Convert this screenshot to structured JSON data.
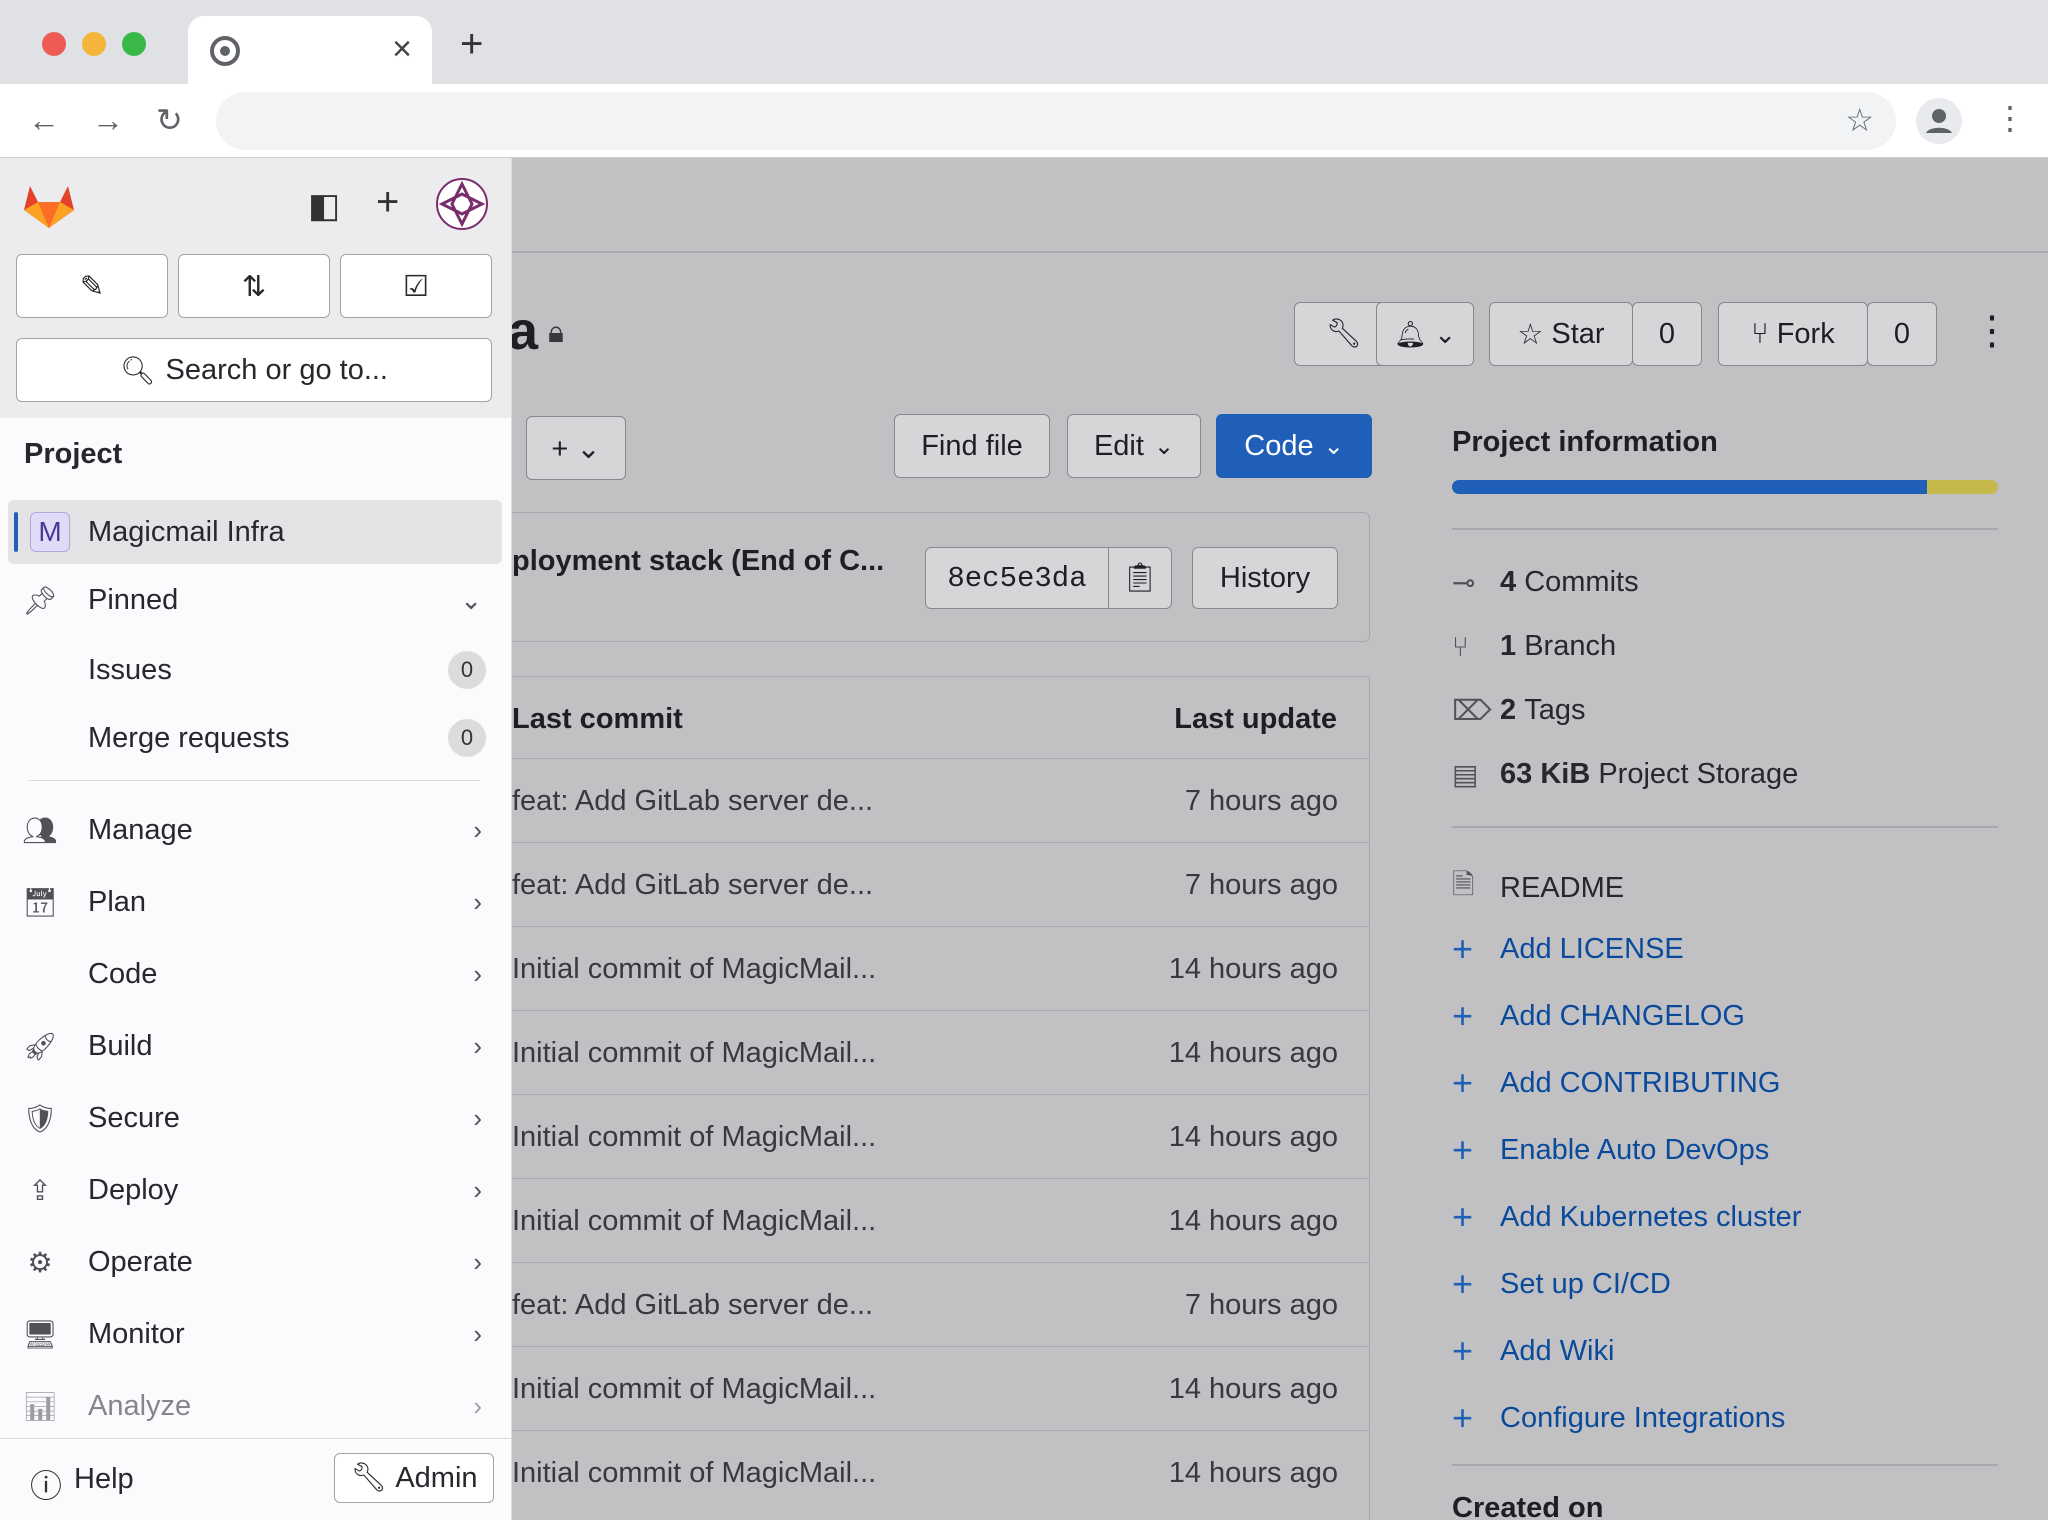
{
  "browser": {
    "tab_close": "×",
    "new_tab": "+"
  },
  "sidebar": {
    "search_placeholder": "Search or go to...",
    "section_title": "Project",
    "project_initial": "M",
    "project_name": "Magicmail Infra",
    "pinned_label": "Pinned",
    "pinned_items": [
      {
        "label": "Issues",
        "count": "0"
      },
      {
        "label": "Merge requests",
        "count": "0"
      }
    ],
    "nav": [
      "Manage",
      "Plan",
      "Code",
      "Build",
      "Secure",
      "Deploy",
      "Operate",
      "Monitor",
      "Analyze"
    ],
    "help_label": "Help",
    "admin_label": "Admin"
  },
  "header": {
    "title_fragment": "a",
    "star_label": "Star",
    "star_count": "0",
    "fork_label": "Fork",
    "fork_count": "0"
  },
  "repo": {
    "find_file": "Find file",
    "edit": "Edit",
    "code": "Code",
    "commit_title": "ployment stack (End of C...",
    "commit_sha": "8ec5e3da",
    "history": "History",
    "col_last_commit": "Last commit",
    "col_last_update": "Last update",
    "rows": [
      {
        "commit": "feat: Add GitLab server de...",
        "time": "7 hours ago"
      },
      {
        "commit": "feat: Add GitLab server de...",
        "time": "7 hours ago"
      },
      {
        "commit": "Initial commit of MagicMail...",
        "time": "14 hours ago"
      },
      {
        "commit": "Initial commit of MagicMail...",
        "time": "14 hours ago"
      },
      {
        "commit": "Initial commit of MagicMail...",
        "time": "14 hours ago"
      },
      {
        "commit": "Initial commit of MagicMail...",
        "time": "14 hours ago"
      },
      {
        "commit": "feat: Add GitLab server de...",
        "time": "7 hours ago"
      },
      {
        "commit": "Initial commit of MagicMail...",
        "time": "14 hours ago"
      },
      {
        "commit": "Initial commit of MagicMail...",
        "time": "14 hours ago"
      }
    ]
  },
  "project_info": {
    "title": "Project information",
    "storage_bar_fraction": 0.87,
    "commits_num": "4",
    "commits_label": "Commits",
    "branch_num": "1",
    "branch_label": "Branch",
    "tags_num": "2",
    "tags_label": "Tags",
    "storage_num": "63 KiB",
    "storage_label": "Project Storage",
    "readme": "README",
    "links": [
      "Add LICENSE",
      "Add CHANGELOG",
      "Add CONTRIBUTING",
      "Enable Auto DevOps",
      "Add Kubernetes cluster",
      "Set up CI/CD",
      "Add Wiki",
      "Configure Integrations"
    ],
    "created_on": "Created on"
  },
  "colors": {
    "accent": "#1f5fb8",
    "storage_primary": "#1f5fb8",
    "storage_secondary": "#c4b94a"
  }
}
